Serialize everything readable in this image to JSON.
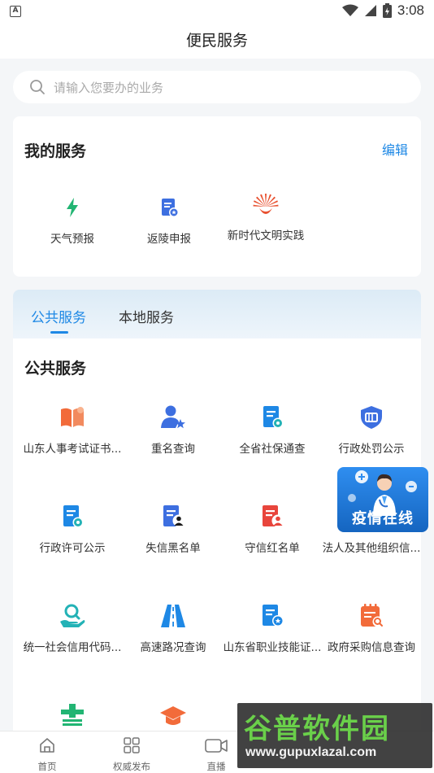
{
  "status_bar": {
    "time": "3:08",
    "left_icon_text": "A"
  },
  "header": {
    "title": "便民服务"
  },
  "search": {
    "placeholder": "请输入您要办的业务"
  },
  "my_services": {
    "title": "我的服务",
    "edit_label": "编辑",
    "items": [
      {
        "label": "天气预报",
        "icon": "lightning-icon"
      },
      {
        "label": "返陵申报",
        "icon": "document-badge-icon"
      },
      {
        "label": "新时代文明实践",
        "icon": "sunflower-logo-icon"
      }
    ]
  },
  "tabs": [
    {
      "label": "公共服务",
      "active": true
    },
    {
      "label": "本地服务",
      "active": false
    }
  ],
  "public_services": {
    "title": "公共服务",
    "items": [
      {
        "label": "山东人事考试证书...",
        "icon": "book-icon"
      },
      {
        "label": "重名查询",
        "icon": "user-star-icon"
      },
      {
        "label": "全省社保通查",
        "icon": "document-badge-icon"
      },
      {
        "label": "行政处罚公示",
        "icon": "shield-icon"
      },
      {
        "label": "行政许可公示",
        "icon": "document-badge-icon"
      },
      {
        "label": "失信黑名单",
        "icon": "document-person-icon"
      },
      {
        "label": "守信红名单",
        "icon": "document-person-icon"
      },
      {
        "label": "法人及其他组织信...",
        "icon": "building-icon"
      },
      {
        "label": "统一社会信用代码...",
        "icon": "hand-search-icon"
      },
      {
        "label": "高速路况查询",
        "icon": "road-icon"
      },
      {
        "label": "山东省职业技能证...",
        "icon": "document-badge-icon"
      },
      {
        "label": "政府采购信息查询",
        "icon": "calendar-search-icon"
      }
    ]
  },
  "float_banner": {
    "label": "疫情在线"
  },
  "bottom_nav": [
    {
      "label": "首页",
      "icon": "home-icon"
    },
    {
      "label": "权威发布",
      "icon": "grid-icon"
    },
    {
      "label": "直播",
      "icon": "video-icon"
    }
  ],
  "watermark": {
    "title": "谷普软件园",
    "url": "www.gupuxlazal.com"
  },
  "colors": {
    "accent": "#1e88e5",
    "orange": "#f26b3a",
    "blue": "#3d6fe0",
    "red": "#e8453c",
    "teal": "#23b2b6",
    "green": "#22b573"
  }
}
